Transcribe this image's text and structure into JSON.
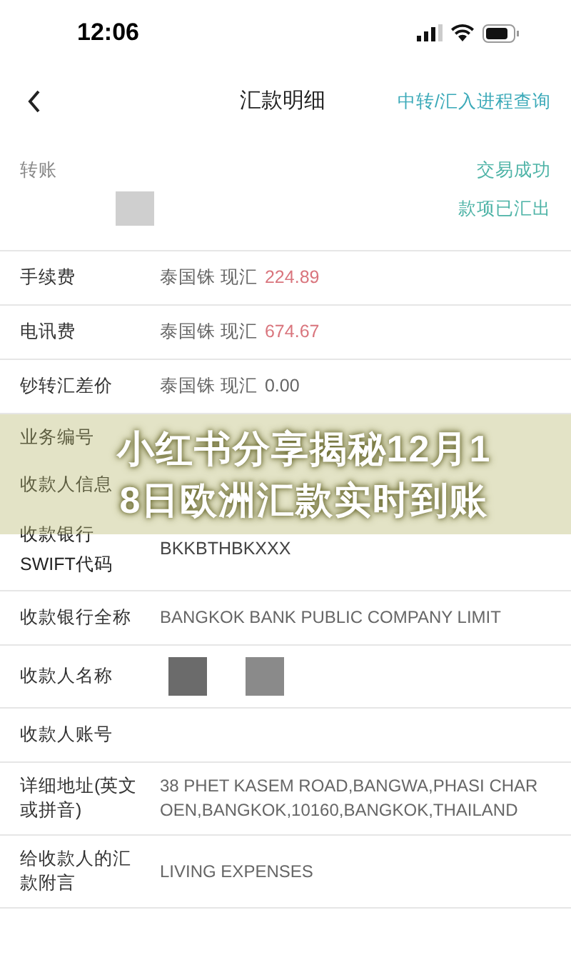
{
  "status_bar": {
    "time": "12:06"
  },
  "nav": {
    "title": "汇款明细",
    "link": "中转/汇入进程查询"
  },
  "summary": {
    "label": "转账",
    "status": "交易成功",
    "note": "款项已汇出"
  },
  "fees": [
    {
      "label": "手续费",
      "currency": "泰国铢 现汇",
      "amount": "224.89",
      "highlight": true
    },
    {
      "label": "电讯费",
      "currency": "泰国铢 现汇",
      "amount": "674.67",
      "highlight": true
    },
    {
      "label": "钞转汇差价",
      "currency": "泰国铢 现汇",
      "amount": "0.00",
      "highlight": false
    }
  ],
  "covered_rows": [
    {
      "label": "业务编号"
    },
    {
      "label": "收款人信息"
    }
  ],
  "swift_row": {
    "label_lines": [
      "收款银行",
      "SWIFT代码"
    ],
    "value": "BKKBTHBKXXX"
  },
  "details": [
    {
      "label": "收款银行全称",
      "value": "BANGKOK BANK PUBLIC COMPANY LIMIT",
      "redacted": false
    },
    {
      "label": "收款人名称",
      "redacted": true
    },
    {
      "label": "收款人账号",
      "redacted": false
    },
    {
      "label": "详细地址(英文或拼音)",
      "value": "38 PHET KASEM ROAD,BANGWA,PHASI CHAROEN,BANGKOK,10160,BANGKOK,THAILAND",
      "redacted": false
    },
    {
      "label": "给收款人的汇款附言",
      "value": "LIVING EXPENSES",
      "redacted": false
    }
  ],
  "banner": {
    "title_lines": [
      "小红书分享揭秘12月1",
      "8日欧洲汇款实时到账"
    ]
  }
}
